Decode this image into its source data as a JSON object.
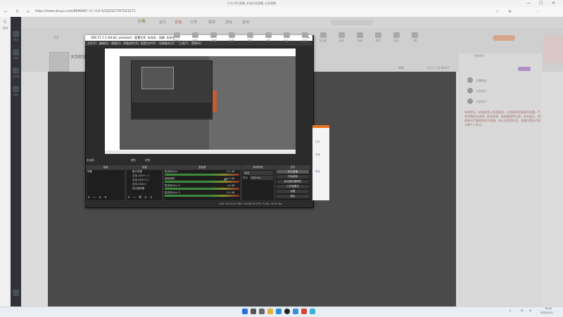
{
  "browser": {
    "tab_title": "（小红书打直播_艺电抖音直播_斗鱼直播",
    "url": "https://www.douyu.com/9696467 (1 / 0.6-5/5ZZ5E7TOTOE1E71",
    "win_min": "—",
    "win_max": "☐",
    "win_close": "✕"
  },
  "sidebar": {
    "items": [
      {
        "label": "首页"
      },
      {
        "label": "动态"
      },
      {
        "label": "云游戏"
      },
      {
        "label": "游戏"
      }
    ],
    "user_label": "登录"
  },
  "site": {
    "logo": "斗鱼",
    "nav": [
      {
        "label": "首页",
        "active": false
      },
      {
        "label": "直播",
        "active": true
      },
      {
        "label": "分类",
        "active": false
      },
      {
        "label": "赛事",
        "active": false
      },
      {
        "label": "游戏",
        "active": false
      },
      {
        "label": "鱼吧",
        "active": false
      }
    ],
    "follow_count": "12",
    "room_title": "大剑师直播",
    "categories": [
      "领鱼丸",
      "开播",
      "斗鱼星",
      "鱼吧",
      "任务",
      "分享",
      "鱼丸",
      "礼物",
      "粉丝团",
      "贵族",
      "充值",
      "勋章",
      "活动",
      "下载"
    ],
    "report_label": "举报",
    "stats": "12.1万   22:40:07"
  },
  "chat": {
    "tab": "主播榜单",
    "users": [
      "主播粉丝",
      "斗鱼用户",
      "斗鱼用户"
    ],
    "notice": "系统提示：欢迎来到斗鱼直播间，本直播间提倡绿色直播，严禁传播违法违规、低俗色情、吸烟酗酒等内容，若有违反，将视情节严重程度给予禁播、永久封禁等处罚。直播内容仅代表主播个人观点。"
  },
  "obs": {
    "title": "OBS 27.1.3 (64-bit, windows) - 配置文件: 未命名 - 场景: 未命名",
    "menu": [
      "文件(F)",
      "编辑(E)",
      "视图(V)",
      "停靠部件(D)",
      "配置文件(P)",
      "场景集合(S)",
      "工具(T)",
      "帮助(H)"
    ],
    "scene_label": "未选源",
    "props_label": "属性",
    "filters_label": "滤镜",
    "docks": {
      "scenes": "场景",
      "sources": "来源",
      "mixer": "混音器",
      "transitions": "转场特效",
      "controls": "控件"
    },
    "scene_item": "场景",
    "sources": [
      "窗口采集",
      "文本 (GDI+) 3",
      "文本 (GDI+) 2",
      "文本 (GDI+)",
      "显示器采集"
    ],
    "mixer": [
      {
        "name": "麦克风/Aux",
        "db": "0.0 dB"
      },
      {
        "name": "桌面音频",
        "db": "0.0 dB"
      },
      {
        "name": "麦克风/Aux 2",
        "db": "-inf dB"
      },
      {
        "name": "麦克风/Aux 3",
        "db": "0.0 dB"
      }
    ],
    "transition": {
      "type": "淡出",
      "duration_label": "时长",
      "duration": "300 ms"
    },
    "controls": [
      {
        "label": "停止直播",
        "active": true
      },
      {
        "label": "开始录制",
        "active": false
      },
      {
        "label": "启动虚拟摄像机",
        "active": false
      },
      {
        "label": "工作室模式",
        "active": false
      },
      {
        "label": "设置",
        "active": false
      },
      {
        "label": "退出",
        "active": false
      }
    ],
    "status": "LIVE: 00:00:22   REC: 00:00:00   CPU: 3.4%, 30.00 fps",
    "add": "+",
    "remove": "−",
    "up": "∧",
    "down": "∨"
  },
  "popup": {
    "lines": [
      "打开",
      "关闭",
      "更多"
    ]
  },
  "taskbar": {
    "time": "16:42",
    "date": "2022/2/11",
    "lang": "中",
    "icons": [
      "windows",
      "search",
      "taskview",
      "explorer",
      "edge",
      "obs",
      "store",
      "chrome",
      "photos"
    ]
  },
  "colors": {
    "accent": "#e8731f",
    "obs_bg": "#2b2b2b",
    "dim_overlay": "#4a4a4a"
  }
}
